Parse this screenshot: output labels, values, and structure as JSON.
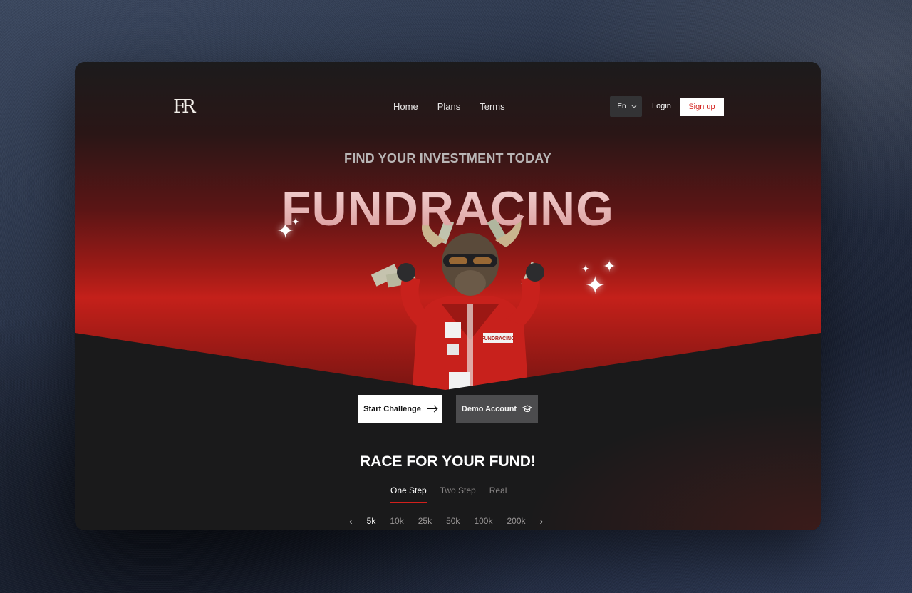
{
  "nav": {
    "logo": "FR",
    "links": [
      "Home",
      "Plans",
      "Terms"
    ],
    "language": "En",
    "login": "Login",
    "signup": "Sign up"
  },
  "hero": {
    "tagline": "FIND YOUR INVESTMENT TODAY",
    "headline": "FUNDRACING",
    "jacket_patch": "FUNDRACING",
    "cta_primary": "Start Challenge",
    "cta_secondary": "Demo Account"
  },
  "section": {
    "title": "RACE FOR YOUR FUND!",
    "tabs": [
      "One Step",
      "Two Step",
      "Real"
    ],
    "active_tab": "One Step",
    "amounts": [
      "5k",
      "10k",
      "25k",
      "50k",
      "100k",
      "200k"
    ],
    "active_amount": "5k"
  },
  "icons": {
    "prev": "chevron-left-icon",
    "next": "chevron-right-icon",
    "arrow": "arrow-right-icon",
    "demo": "graduation-cap-icon",
    "lang": "chevron-down-icon"
  },
  "colors": {
    "accent": "#d3201c",
    "background": "#1a1a1b",
    "hero_red": "#c4201a"
  }
}
